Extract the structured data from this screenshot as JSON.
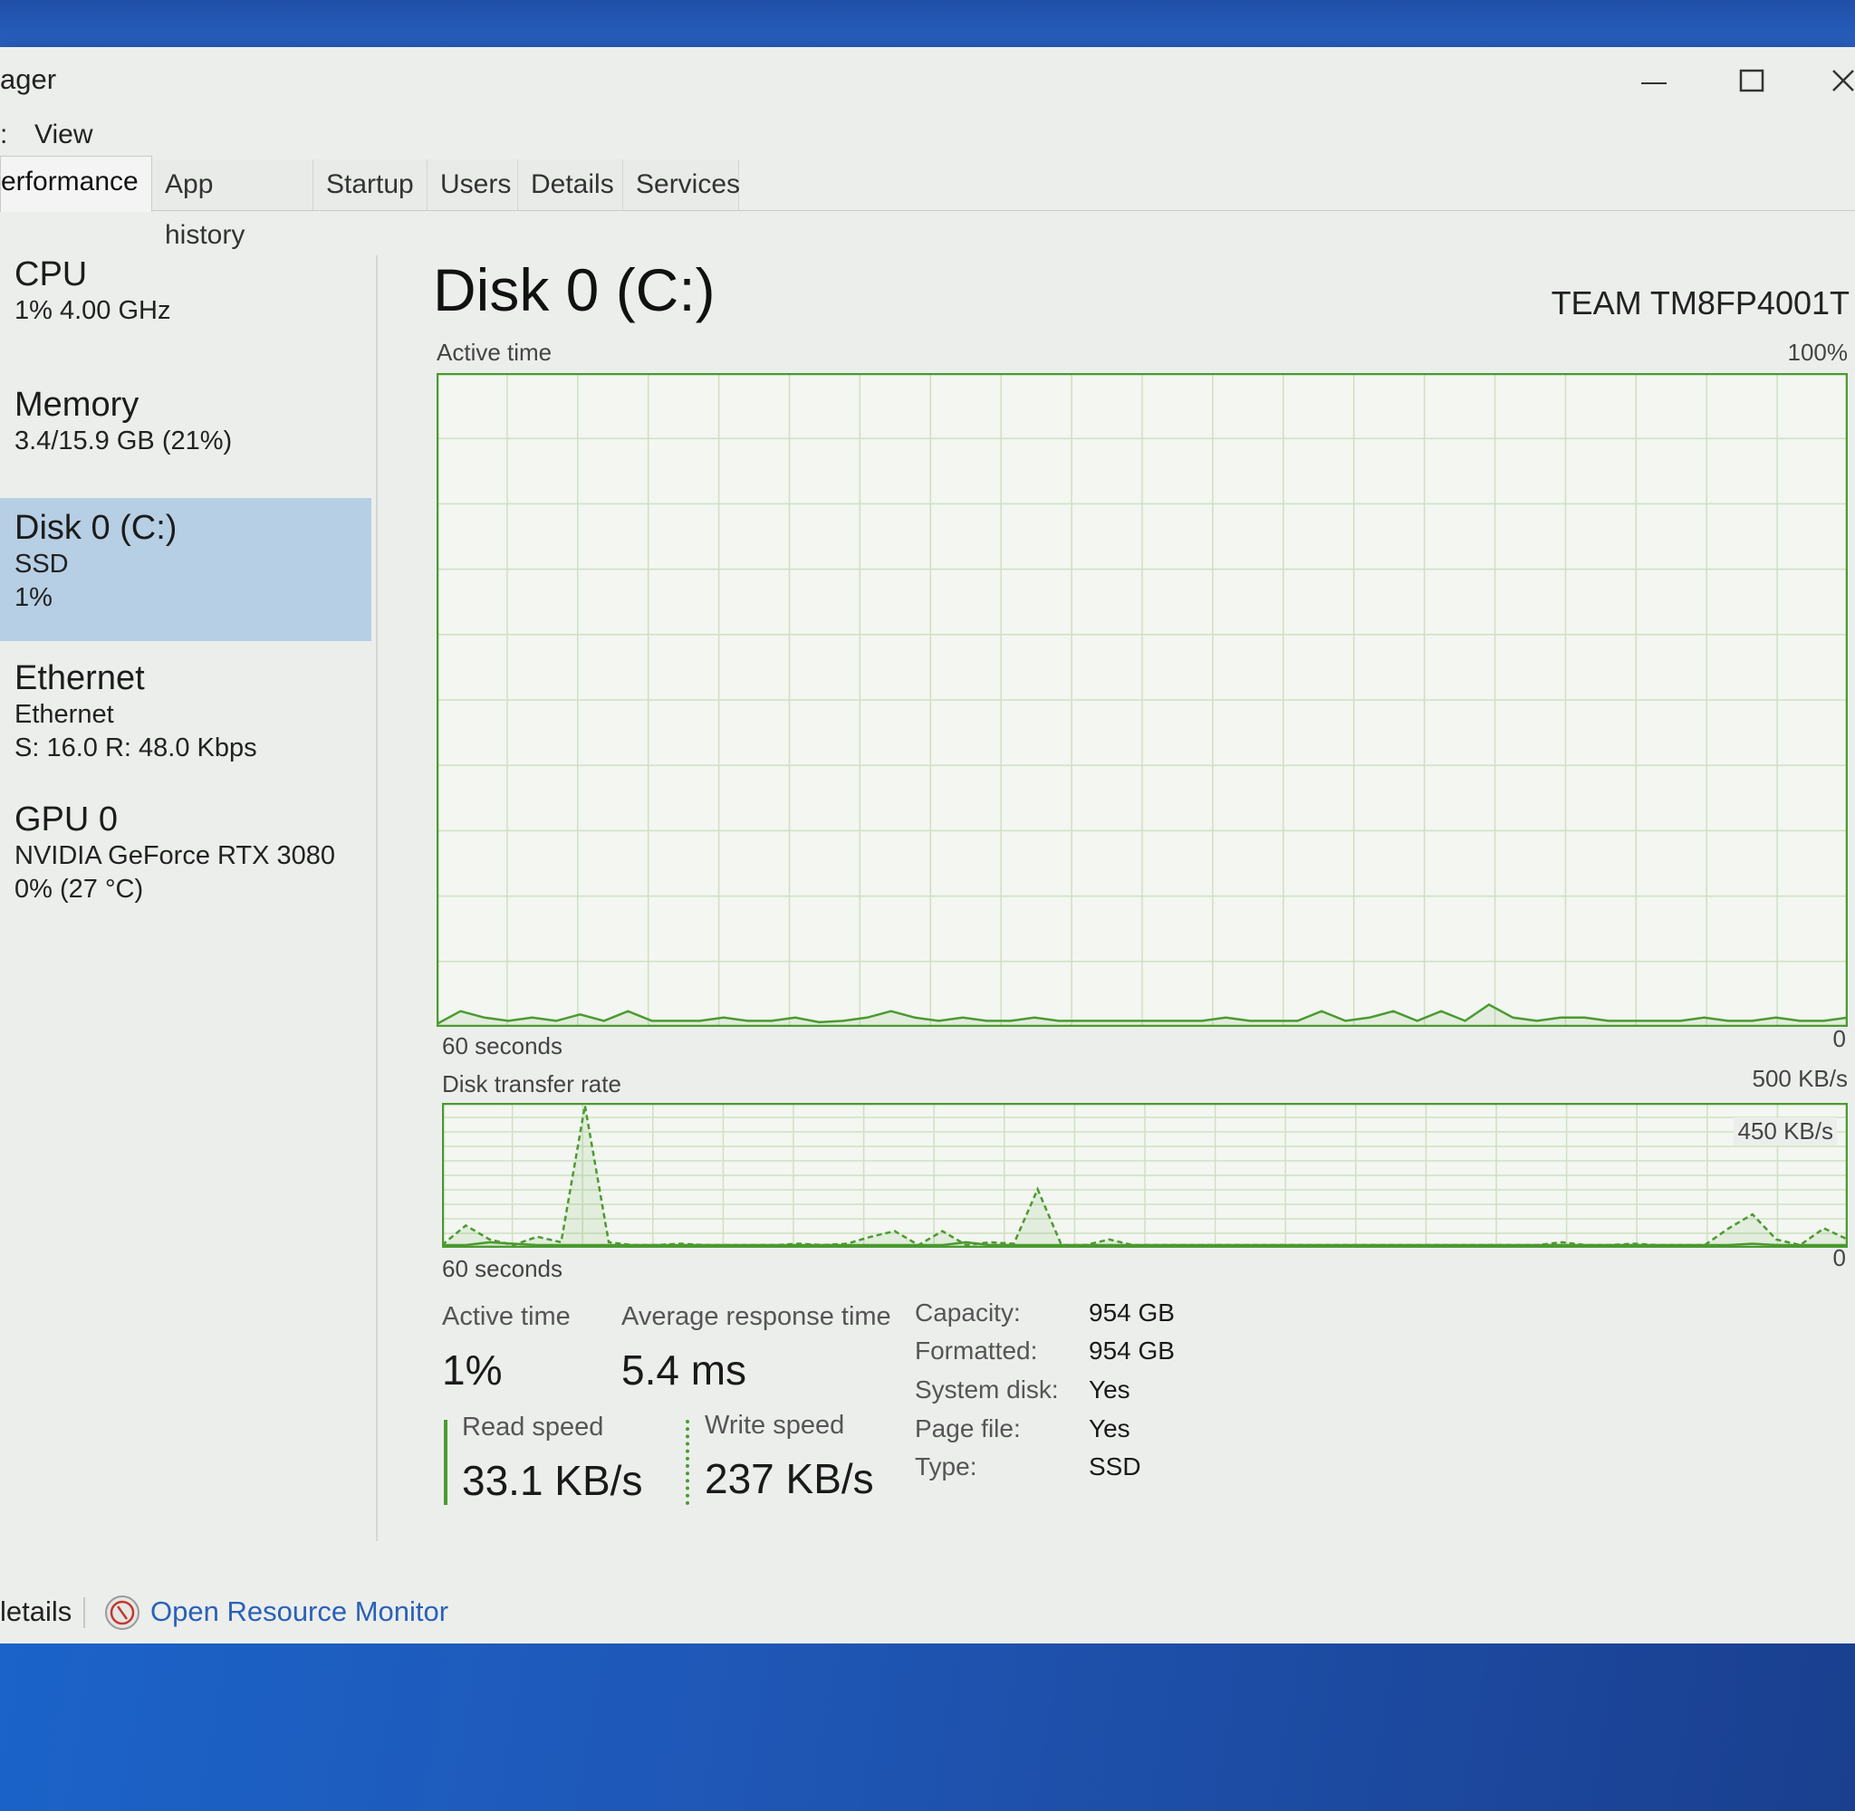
{
  "window": {
    "title": "ager",
    "minimize_icon": "minimize-icon",
    "maximize_icon": "maximize-icon",
    "close_icon": "close-icon"
  },
  "menu": {
    "items": [
      ":",
      "View"
    ]
  },
  "tabs": [
    "erformance",
    "App history",
    "Startup",
    "Users",
    "Details",
    "Services"
  ],
  "sidebar": {
    "items": [
      {
        "title": "CPU",
        "lines": [
          "1%  4.00 GHz"
        ]
      },
      {
        "title": "Memory",
        "lines": [
          "3.4/15.9 GB (21%)"
        ]
      },
      {
        "title": "Disk 0 (C:)",
        "lines": [
          "SSD",
          "1%"
        ]
      },
      {
        "title": "Ethernet",
        "lines": [
          "Ethernet",
          "S: 16.0  R: 48.0 Kbps"
        ]
      },
      {
        "title": "GPU 0",
        "lines": [
          "NVIDIA GeForce RTX 3080",
          "0%  (27 °C)"
        ]
      }
    ]
  },
  "main": {
    "title": "Disk 0 (C:)",
    "model": "TEAM TM8FP4001T"
  },
  "graph_active": {
    "label": "Active time",
    "max_label": "100%",
    "time_label": "60 seconds",
    "min_label": "0",
    "values": [
      0,
      2,
      1,
      0.5,
      1,
      0.5,
      1.5,
      0.5,
      2,
      0.5,
      0.5,
      0.5,
      1,
      0.5,
      0.5,
      1,
      0.3,
      0.5,
      1,
      2,
      1,
      0.5,
      1,
      0.5,
      0.5,
      1,
      0.5,
      0.5,
      0.5,
      0.5,
      0.5,
      0.5,
      0.5,
      1,
      0.5,
      0.5,
      0.5,
      2,
      0.5,
      1,
      2,
      0.5,
      2,
      0.5,
      3,
      1,
      0.5,
      1,
      1,
      0.5,
      0.5,
      0.5,
      0.5,
      1,
      0.5,
      0.5,
      1,
      0.5,
      0.5,
      1
    ]
  },
  "graph_transfer": {
    "label": "Disk transfer rate",
    "max_label": "500 KB/s",
    "inner_label": "450 KB/s",
    "time_label": "60 seconds",
    "min_label": "0",
    "read_values": [
      0,
      0,
      10,
      5,
      0,
      0,
      0,
      0,
      0,
      0,
      0,
      0,
      0,
      0,
      0,
      0,
      0,
      0,
      0,
      0,
      0,
      0,
      10,
      0,
      0,
      0,
      0,
      0,
      0,
      0,
      0,
      0,
      0,
      0,
      0,
      0,
      0,
      0,
      0,
      0,
      0,
      0,
      0,
      0,
      0,
      0,
      0,
      0,
      0,
      0,
      0,
      0,
      0,
      0,
      0,
      5,
      0,
      0,
      0,
      0
    ],
    "write_values": [
      0,
      70,
      20,
      0,
      30,
      10,
      500,
      10,
      0,
      0,
      5,
      0,
      0,
      0,
      0,
      5,
      0,
      5,
      30,
      50,
      0,
      50,
      0,
      10,
      5,
      200,
      0,
      0,
      20,
      0,
      0,
      0,
      0,
      0,
      0,
      0,
      0,
      0,
      0,
      0,
      0,
      0,
      0,
      0,
      0,
      0,
      0,
      10,
      0,
      0,
      5,
      0,
      0,
      0,
      60,
      110,
      20,
      0,
      60,
      20
    ]
  },
  "stats": {
    "active_time_label": "Active time",
    "active_time_value": "1%",
    "avg_response_label": "Average response time",
    "avg_response_value": "5.4 ms",
    "read_label": "Read speed",
    "read_value": "33.1 KB/s",
    "write_label": "Write speed",
    "write_value": "237 KB/s"
  },
  "properties": [
    {
      "label": "Capacity:",
      "value": "954 GB"
    },
    {
      "label": "Formatted:",
      "value": "954 GB"
    },
    {
      "label": "System disk:",
      "value": "Yes"
    },
    {
      "label": "Page file:",
      "value": "Yes"
    },
    {
      "label": "Type:",
      "value": "SSD"
    }
  ],
  "footer": {
    "fewer_details": "letails",
    "open_resource_monitor": "Open Resource Monitor"
  },
  "colors": {
    "graph_line": "#4b9a2f",
    "graph_grid": "#cfe0c2",
    "sidebar_selected": "#b6cfe4",
    "link": "#2a61b8"
  }
}
